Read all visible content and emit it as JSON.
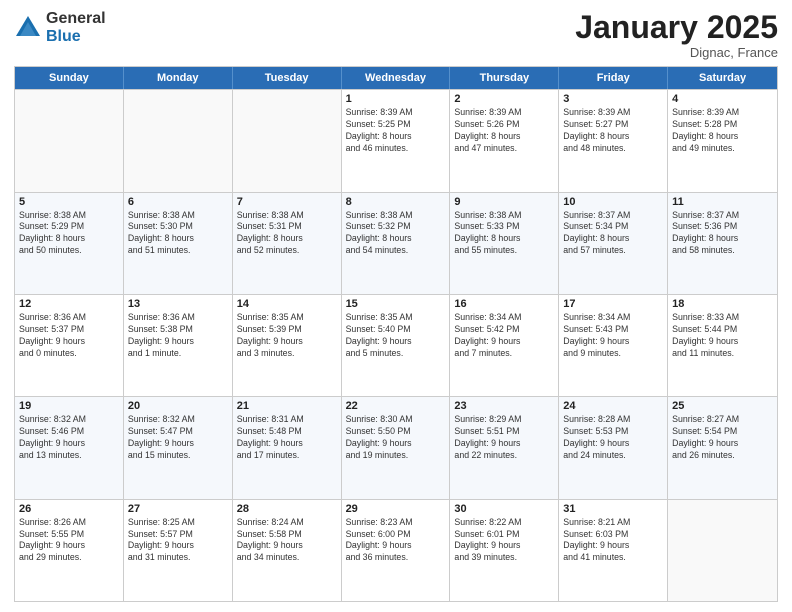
{
  "logo": {
    "general": "General",
    "blue": "Blue"
  },
  "title": "January 2025",
  "location": "Dignac, France",
  "weekdays": [
    "Sunday",
    "Monday",
    "Tuesday",
    "Wednesday",
    "Thursday",
    "Friday",
    "Saturday"
  ],
  "rows": [
    [
      {
        "day": "",
        "info": ""
      },
      {
        "day": "",
        "info": ""
      },
      {
        "day": "",
        "info": ""
      },
      {
        "day": "1",
        "info": "Sunrise: 8:39 AM\nSunset: 5:25 PM\nDaylight: 8 hours\nand 46 minutes."
      },
      {
        "day": "2",
        "info": "Sunrise: 8:39 AM\nSunset: 5:26 PM\nDaylight: 8 hours\nand 47 minutes."
      },
      {
        "day": "3",
        "info": "Sunrise: 8:39 AM\nSunset: 5:27 PM\nDaylight: 8 hours\nand 48 minutes."
      },
      {
        "day": "4",
        "info": "Sunrise: 8:39 AM\nSunset: 5:28 PM\nDaylight: 8 hours\nand 49 minutes."
      }
    ],
    [
      {
        "day": "5",
        "info": "Sunrise: 8:38 AM\nSunset: 5:29 PM\nDaylight: 8 hours\nand 50 minutes."
      },
      {
        "day": "6",
        "info": "Sunrise: 8:38 AM\nSunset: 5:30 PM\nDaylight: 8 hours\nand 51 minutes."
      },
      {
        "day": "7",
        "info": "Sunrise: 8:38 AM\nSunset: 5:31 PM\nDaylight: 8 hours\nand 52 minutes."
      },
      {
        "day": "8",
        "info": "Sunrise: 8:38 AM\nSunset: 5:32 PM\nDaylight: 8 hours\nand 54 minutes."
      },
      {
        "day": "9",
        "info": "Sunrise: 8:38 AM\nSunset: 5:33 PM\nDaylight: 8 hours\nand 55 minutes."
      },
      {
        "day": "10",
        "info": "Sunrise: 8:37 AM\nSunset: 5:34 PM\nDaylight: 8 hours\nand 57 minutes."
      },
      {
        "day": "11",
        "info": "Sunrise: 8:37 AM\nSunset: 5:36 PM\nDaylight: 8 hours\nand 58 minutes."
      }
    ],
    [
      {
        "day": "12",
        "info": "Sunrise: 8:36 AM\nSunset: 5:37 PM\nDaylight: 9 hours\nand 0 minutes."
      },
      {
        "day": "13",
        "info": "Sunrise: 8:36 AM\nSunset: 5:38 PM\nDaylight: 9 hours\nand 1 minute."
      },
      {
        "day": "14",
        "info": "Sunrise: 8:35 AM\nSunset: 5:39 PM\nDaylight: 9 hours\nand 3 minutes."
      },
      {
        "day": "15",
        "info": "Sunrise: 8:35 AM\nSunset: 5:40 PM\nDaylight: 9 hours\nand 5 minutes."
      },
      {
        "day": "16",
        "info": "Sunrise: 8:34 AM\nSunset: 5:42 PM\nDaylight: 9 hours\nand 7 minutes."
      },
      {
        "day": "17",
        "info": "Sunrise: 8:34 AM\nSunset: 5:43 PM\nDaylight: 9 hours\nand 9 minutes."
      },
      {
        "day": "18",
        "info": "Sunrise: 8:33 AM\nSunset: 5:44 PM\nDaylight: 9 hours\nand 11 minutes."
      }
    ],
    [
      {
        "day": "19",
        "info": "Sunrise: 8:32 AM\nSunset: 5:46 PM\nDaylight: 9 hours\nand 13 minutes."
      },
      {
        "day": "20",
        "info": "Sunrise: 8:32 AM\nSunset: 5:47 PM\nDaylight: 9 hours\nand 15 minutes."
      },
      {
        "day": "21",
        "info": "Sunrise: 8:31 AM\nSunset: 5:48 PM\nDaylight: 9 hours\nand 17 minutes."
      },
      {
        "day": "22",
        "info": "Sunrise: 8:30 AM\nSunset: 5:50 PM\nDaylight: 9 hours\nand 19 minutes."
      },
      {
        "day": "23",
        "info": "Sunrise: 8:29 AM\nSunset: 5:51 PM\nDaylight: 9 hours\nand 22 minutes."
      },
      {
        "day": "24",
        "info": "Sunrise: 8:28 AM\nSunset: 5:53 PM\nDaylight: 9 hours\nand 24 minutes."
      },
      {
        "day": "25",
        "info": "Sunrise: 8:27 AM\nSunset: 5:54 PM\nDaylight: 9 hours\nand 26 minutes."
      }
    ],
    [
      {
        "day": "26",
        "info": "Sunrise: 8:26 AM\nSunset: 5:55 PM\nDaylight: 9 hours\nand 29 minutes."
      },
      {
        "day": "27",
        "info": "Sunrise: 8:25 AM\nSunset: 5:57 PM\nDaylight: 9 hours\nand 31 minutes."
      },
      {
        "day": "28",
        "info": "Sunrise: 8:24 AM\nSunset: 5:58 PM\nDaylight: 9 hours\nand 34 minutes."
      },
      {
        "day": "29",
        "info": "Sunrise: 8:23 AM\nSunset: 6:00 PM\nDaylight: 9 hours\nand 36 minutes."
      },
      {
        "day": "30",
        "info": "Sunrise: 8:22 AM\nSunset: 6:01 PM\nDaylight: 9 hours\nand 39 minutes."
      },
      {
        "day": "31",
        "info": "Sunrise: 8:21 AM\nSunset: 6:03 PM\nDaylight: 9 hours\nand 41 minutes."
      },
      {
        "day": "",
        "info": ""
      }
    ]
  ]
}
